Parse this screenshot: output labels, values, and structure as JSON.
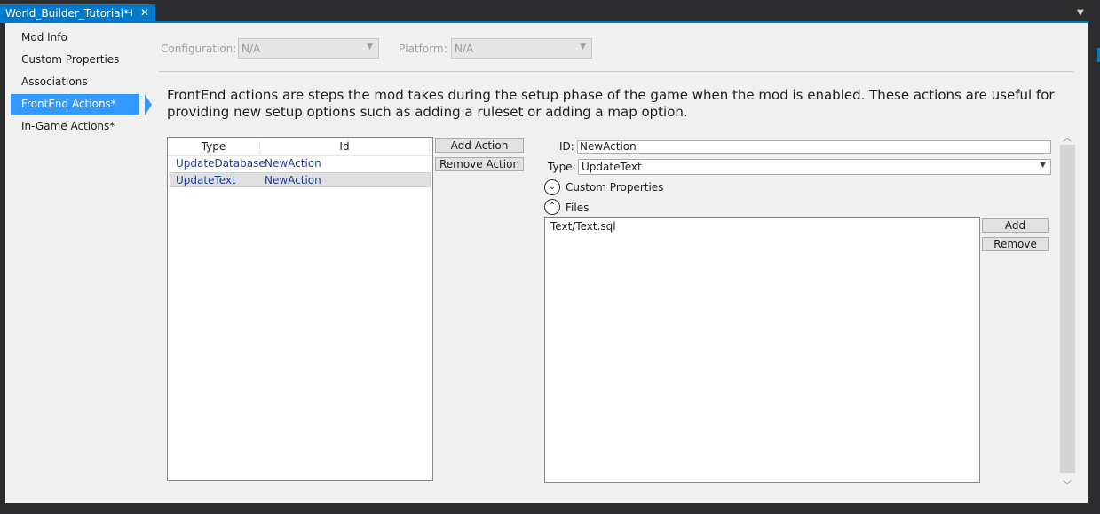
{
  "tab": {
    "title": "World_Builder_Tutorial*",
    "pin_icon": "pin-icon",
    "close_icon": "close-icon",
    "accent": "#007acc"
  },
  "sidebar": {
    "items": [
      {
        "label": "Mod Info"
      },
      {
        "label": "Custom Properties"
      },
      {
        "label": "Associations"
      },
      {
        "label": "FrontEnd Actions*"
      },
      {
        "label": "In-Game Actions*"
      }
    ],
    "active_index": 3,
    "active_color": "#3399ff"
  },
  "config": {
    "configuration_label": "Configuration:",
    "configuration_value": "N/A",
    "platform_label": "Platform:",
    "platform_value": "N/A"
  },
  "description": "FrontEnd actions are steps the mod takes during the setup phase of the game when the mod is enabled.  These actions are useful for providing new setup options such as adding a ruleset or adding a map option.",
  "actions": {
    "columns": [
      "Type",
      "Id"
    ],
    "rows": [
      {
        "type": "UpdateDatabase",
        "id": "NewAction"
      },
      {
        "type": "UpdateText",
        "id": "NewAction"
      }
    ],
    "selected_index": 1,
    "add_label": "Add Action",
    "remove_label": "Remove Action"
  },
  "detail": {
    "id_label": "ID:",
    "id_value": "NewAction",
    "type_label": "Type:",
    "type_value": "UpdateText",
    "custom_properties_label": "Custom Properties",
    "files_label": "Files",
    "files": [
      "Text/Text.sql"
    ],
    "add_label": "Add",
    "remove_label": "Remove"
  }
}
